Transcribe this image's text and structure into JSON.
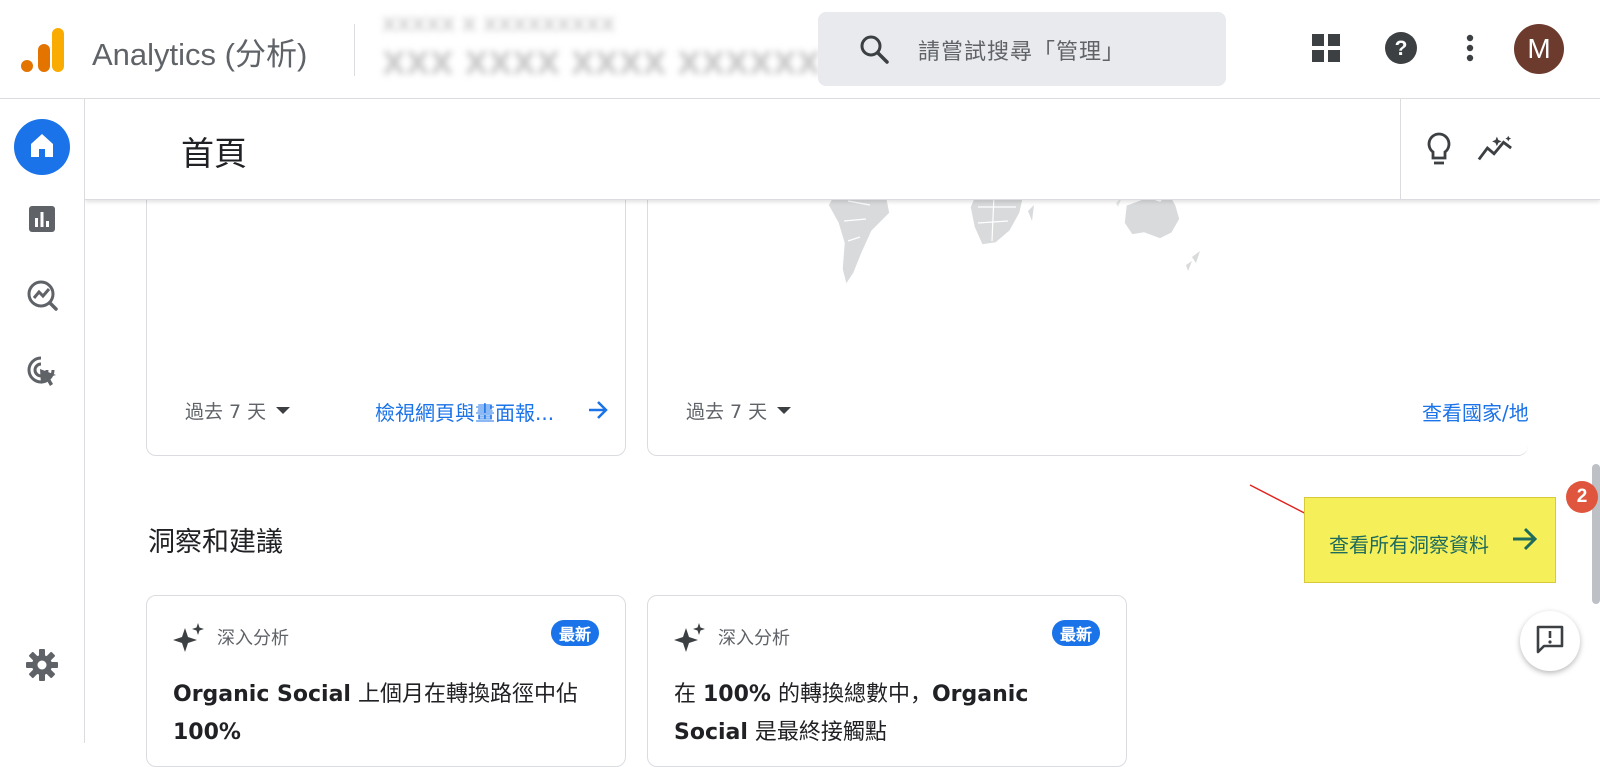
{
  "app": {
    "title": "Analytics (分析)",
    "account_line1": "XXXXX X XXXXXXXXX",
    "account_line2": "XXX XXXX XXXX XXXXXXX"
  },
  "search": {
    "placeholder": "請嘗試搜尋「管理」"
  },
  "topbar_icons": [
    "apps-grid-icon",
    "help-icon",
    "more-vert-icon"
  ],
  "avatar": {
    "initial": "M",
    "color": "#6d3a2e"
  },
  "leftnav": {
    "items": [
      {
        "name": "home",
        "icon": "home-icon",
        "active": true
      },
      {
        "name": "reports",
        "icon": "bar-chart-icon",
        "active": false
      },
      {
        "name": "explore",
        "icon": "explore-trend-icon",
        "active": false
      },
      {
        "name": "advertising",
        "icon": "ads-target-icon",
        "active": false
      }
    ],
    "settings_icon": "gear-icon"
  },
  "page": {
    "title": "首頁",
    "header_icons": [
      "lightbulb-icon",
      "insights-sparkline-icon"
    ]
  },
  "cards_top": [
    {
      "range": "過去 7 天",
      "link": "檢視網頁與畫面報..."
    },
    {
      "range": "過去 7 天",
      "link": "查看國家/地"
    }
  ],
  "insights_section": {
    "title": "洞察和建議",
    "view_all_label": "查看所有洞察資料",
    "annotation_step": "2",
    "cards": [
      {
        "kicker": "深入分析",
        "badge": "最新",
        "text_bold1": "Organic Social",
        "text_rest1": " 上個月在轉換路徑中佔 ",
        "text_bold2": "100%",
        "text_rest2": ""
      },
      {
        "kicker": "深入分析",
        "badge": "最新",
        "text_pre": "在 ",
        "text_bold1": "100%",
        "text_rest1": " 的轉換總數中，",
        "text_bold2": "Organic Social",
        "text_rest2": " 是最終接觸點"
      }
    ]
  },
  "colors": {
    "accent": "#1a73e8",
    "highlight": "#f5f05a",
    "annotation": "#e0553d",
    "logo_orange": "#f9ab00",
    "logo_dark_orange": "#e37400"
  }
}
